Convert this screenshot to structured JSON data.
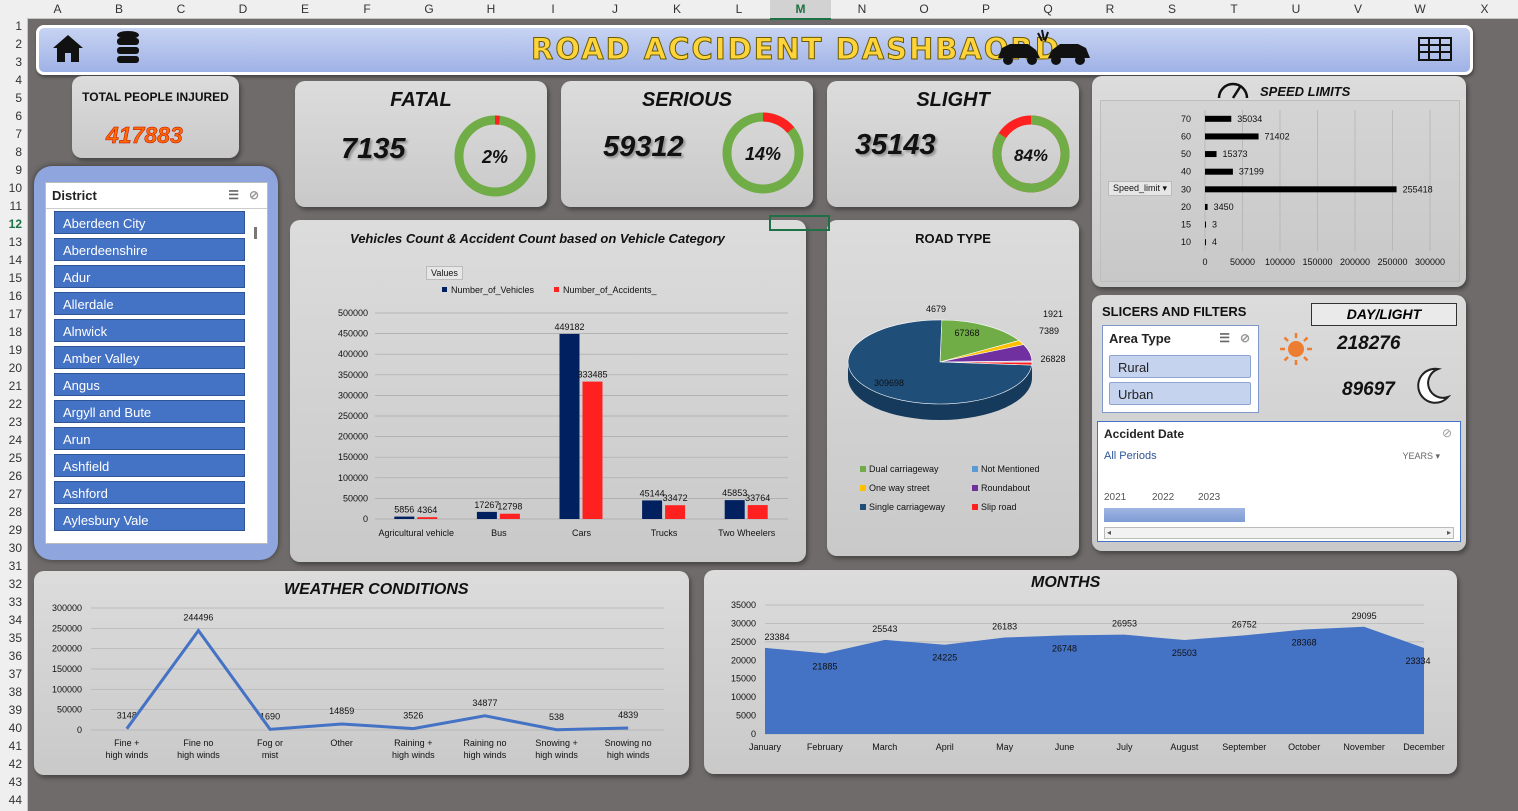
{
  "sheet": {
    "columns": [
      "A",
      "B",
      "C",
      "D",
      "E",
      "F",
      "G",
      "H",
      "I",
      "J",
      "K",
      "L",
      "M",
      "N",
      "O",
      "P",
      "Q",
      "R",
      "S",
      "T",
      "U",
      "V",
      "W",
      "X"
    ],
    "selected_column": "M",
    "rows": [
      "1",
      "2",
      "3",
      "4",
      "5",
      "6",
      "7",
      "8",
      "9",
      "10",
      "11",
      "12",
      "13",
      "14",
      "15",
      "16",
      "17",
      "18",
      "19",
      "20",
      "21",
      "22",
      "23",
      "24",
      "25",
      "26",
      "27",
      "28",
      "29",
      "30",
      "31",
      "32",
      "33",
      "34",
      "35",
      "36",
      "37",
      "38",
      "39",
      "40",
      "41",
      "42",
      "43",
      "44"
    ],
    "selected_row": "12"
  },
  "dashboard": {
    "title": "ROAD ACCIDENT DASHBAORD"
  },
  "kpi": {
    "total_label": "TOTAL PEOPLE INJURED",
    "total_value": "417883",
    "fatal": {
      "label": "FATAL",
      "value": "7135",
      "pct_label": "2%",
      "pct": 0.02
    },
    "serious": {
      "label": "SERIOUS",
      "value": "59312",
      "pct_label": "14%",
      "pct": 0.14
    },
    "slight": {
      "label": "SLIGHT",
      "value": "35143",
      "pct_label": "84%",
      "pct": 0.84
    }
  },
  "district_slicer": {
    "header": "District",
    "items": [
      "Aberdeen City",
      "Aberdeenshire",
      "Adur",
      "Allerdale",
      "Alnwick",
      "Amber Valley",
      "Angus",
      "Argyll and Bute",
      "Arun",
      "Ashfield",
      "Ashford",
      "Aylesbury Vale"
    ]
  },
  "filters": {
    "heading": "SLICERS AND FILTERS",
    "area_type": {
      "header": "Area Type",
      "items": [
        "Rural",
        "Urban"
      ]
    },
    "daylight": {
      "label": "DAY/LIGHT",
      "day_value": "218276",
      "night_value": "89697"
    },
    "accident_date": {
      "header": "Accident Date",
      "period": "All Periods",
      "unit": "YEARS",
      "years": [
        "2021",
        "2022",
        "2023"
      ]
    }
  },
  "colors": {
    "accent_blue": "#4472c4",
    "navy": "#002060",
    "red": "#ff2020",
    "green": "#70ad47",
    "title_yellow": "#ffd43b"
  },
  "chart_data": [
    {
      "id": "vehicles",
      "type": "bar",
      "title": "Vehicles Count & Accident Count based on Vehicle Category",
      "field_button": "Values",
      "categories": [
        "Agricultural vehicle",
        "Bus",
        "Cars",
        "Trucks",
        "Two Wheelers"
      ],
      "series": [
        {
          "name": "Number_of_Vehicles",
          "color": "#002060",
          "values": [
            5856,
            17267,
            449182,
            45144,
            45853
          ]
        },
        {
          "name": "Number_of_Accidents_",
          "color": "#ff2020",
          "values": [
            4364,
            12798,
            333485,
            33472,
            33764
          ]
        }
      ],
      "ylim": [
        0,
        500000
      ],
      "yticks": [
        "0",
        "50000",
        "100000",
        "150000",
        "200000",
        "250000",
        "300000",
        "350000",
        "400000",
        "450000",
        "500000"
      ],
      "grid": true,
      "legend": "top"
    },
    {
      "id": "roadtype",
      "type": "pie",
      "title": "ROAD TYPE",
      "slices": [
        {
          "name": "Single carriageway",
          "value": 309698,
          "color": "#1f4e79"
        },
        {
          "name": "Dual carriageway",
          "value": 67368,
          "color": "#70ad47"
        },
        {
          "name": "One way street",
          "value": 7389,
          "color": "#ffc000"
        },
        {
          "name": "Roundabout",
          "value": 26828,
          "color": "#7030a0"
        },
        {
          "name": "Not Mentioned",
          "value": 1921,
          "color": "#5b9bd5"
        },
        {
          "name": "Slip road",
          "value": 4679,
          "color": "#ff2020"
        }
      ],
      "legend": "bottom"
    },
    {
      "id": "speed",
      "type": "bar",
      "orientation": "horizontal",
      "title": "SPEED LIMITS",
      "field_button": "Speed_limit",
      "categories": [
        "70",
        "60",
        "50",
        "40",
        "30",
        "20",
        "15",
        "10"
      ],
      "values": [
        35034,
        71402,
        15373,
        37199,
        255418,
        3450,
        3,
        4
      ],
      "xlim": [
        0,
        300000
      ],
      "xticks": [
        "0",
        "50000",
        "100000",
        "150000",
        "200000",
        "250000",
        "300000"
      ],
      "grid": true
    },
    {
      "id": "weather",
      "type": "line",
      "title": "WEATHER CONDITIONS",
      "categories": [
        "Fine + high winds",
        "Fine no high winds",
        "Fog or mist",
        "Other",
        "Raining + high winds",
        "Raining no high winds",
        "Snowing + high winds",
        "Snowing no high winds"
      ],
      "values": [
        3148,
        244496,
        1690,
        14859,
        3526,
        34877,
        538,
        4839
      ],
      "ylim": [
        0,
        300000
      ],
      "yticks": [
        "0",
        "50000",
        "100000",
        "150000",
        "200000",
        "250000",
        "300000"
      ],
      "grid": true
    },
    {
      "id": "months",
      "type": "area",
      "title": "MONTHS",
      "categories": [
        "January",
        "February",
        "March",
        "April",
        "May",
        "June",
        "July",
        "August",
        "September",
        "October",
        "November",
        "December"
      ],
      "values": [
        23384,
        21885,
        25543,
        24225,
        26183,
        26748,
        26953,
        25503,
        26752,
        28368,
        29095,
        23334
      ],
      "ylim": [
        0,
        35000
      ],
      "yticks": [
        "0",
        "5000",
        "10000",
        "15000",
        "20000",
        "25000",
        "30000",
        "35000"
      ],
      "grid": true
    }
  ]
}
